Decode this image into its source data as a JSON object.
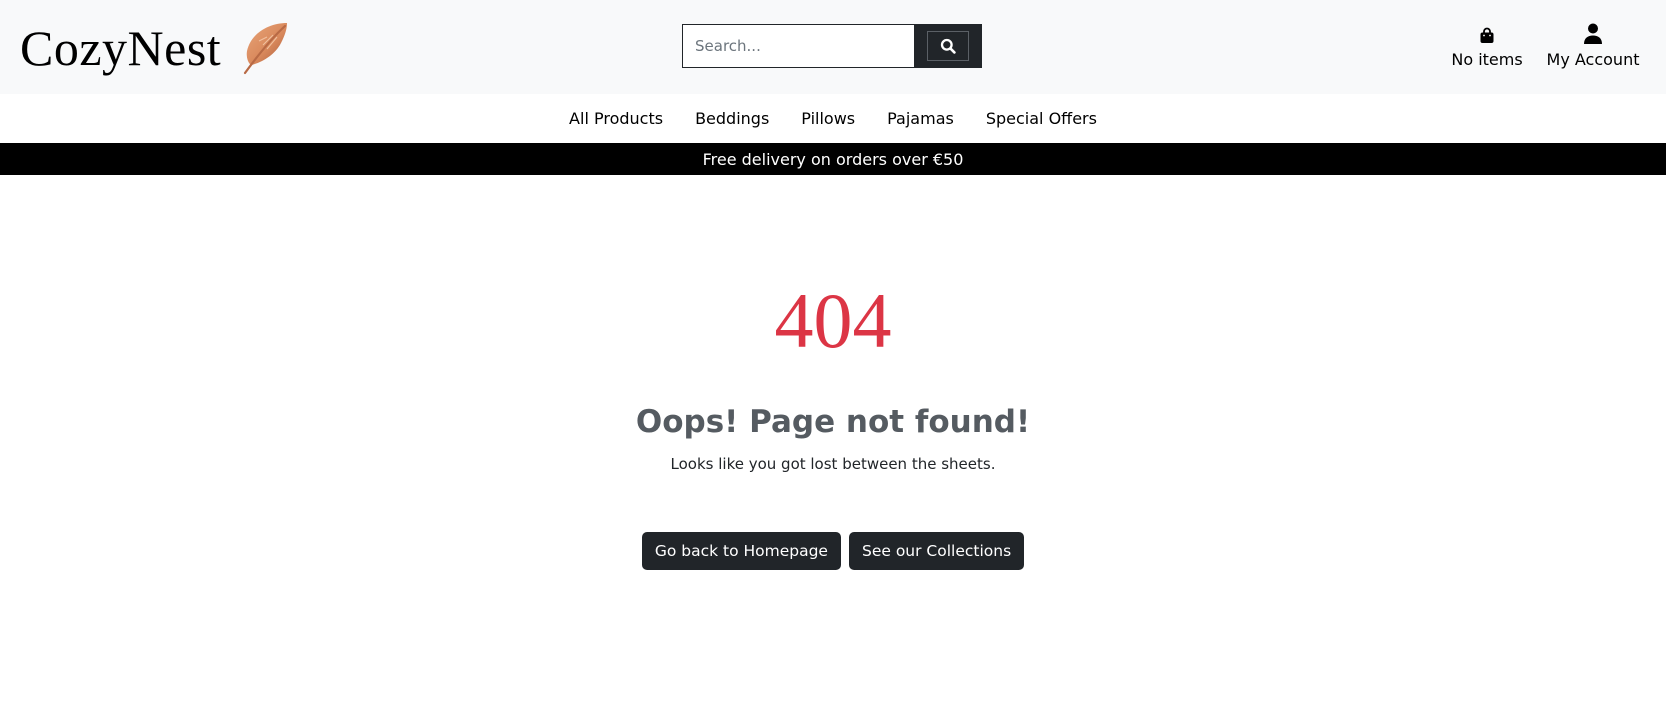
{
  "header": {
    "brand_name": "CozyNest",
    "brand_icon": "feather-icon",
    "search": {
      "placeholder": "Search...",
      "value": "",
      "button_icon": "search-icon"
    },
    "bag": {
      "icon": "shopping-bag-icon",
      "label": "No items"
    },
    "account": {
      "icon": "user-icon",
      "label": "My Account"
    }
  },
  "nav": {
    "items": [
      "All Products",
      "Beddings",
      "Pillows",
      "Pajamas",
      "Special Offers"
    ]
  },
  "banner": {
    "text": "Free delivery on orders over €50"
  },
  "error": {
    "code": "404",
    "title": "Oops! Page not found!",
    "subtitle": "Looks like you got lost between the sheets."
  },
  "actions": {
    "home_label": "Go back to Homepage",
    "collections_label": "See our Collections"
  },
  "colors": {
    "accent_red": "#dc3545",
    "dark": "#212529",
    "header_bg": "#f8f9fa",
    "banner_bg": "#000000",
    "feather": "#d9895c"
  }
}
